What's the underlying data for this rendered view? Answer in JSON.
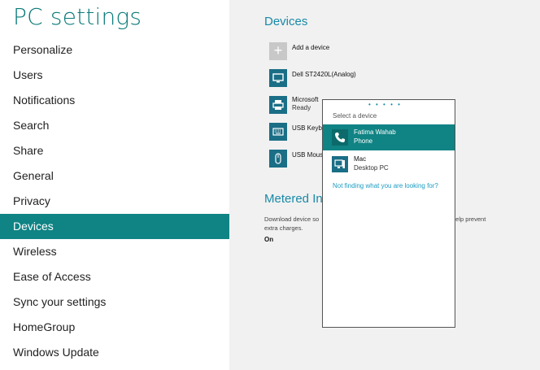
{
  "sidebar": {
    "title": "PC settings",
    "items": [
      {
        "label": "Personalize"
      },
      {
        "label": "Users"
      },
      {
        "label": "Notifications"
      },
      {
        "label": "Search"
      },
      {
        "label": "Share"
      },
      {
        "label": "General"
      },
      {
        "label": "Privacy"
      },
      {
        "label": "Devices",
        "selected": true
      },
      {
        "label": "Wireless"
      },
      {
        "label": "Ease of Access"
      },
      {
        "label": "Sync your settings"
      },
      {
        "label": "HomeGroup"
      },
      {
        "label": "Windows Update"
      }
    ]
  },
  "devices": {
    "title": "Devices",
    "add_label": "Add a device",
    "items": [
      {
        "name": "Dell ST2420L(Analog)",
        "icon": "monitor-icon"
      },
      {
        "name": "Microsoft",
        "status": "Ready",
        "icon": "printer-icon"
      },
      {
        "name": "USB Keybo",
        "icon": "keyboard-icon"
      },
      {
        "name": "USB Mous",
        "icon": "mouse-icon"
      }
    ]
  },
  "metered": {
    "title": "Metered Int",
    "desc_left": "Download device so",
    "desc_right": "help prevent",
    "desc_line2": "extra charges.",
    "value": "On"
  },
  "popup": {
    "header": "Select a device",
    "dots": "• • • • •",
    "items": [
      {
        "name": "Fatima Wahab",
        "type": "Phone",
        "icon": "phone-icon",
        "selected": true
      },
      {
        "name": "Mac",
        "type": "Desktop PC",
        "icon": "desktop-pc-icon"
      }
    ],
    "link": "Not finding what you are looking for?"
  },
  "colors": {
    "accent": "#108384",
    "title": "#0b7a7a",
    "link": "#1a9cc2",
    "section_title": "#1889a8"
  }
}
